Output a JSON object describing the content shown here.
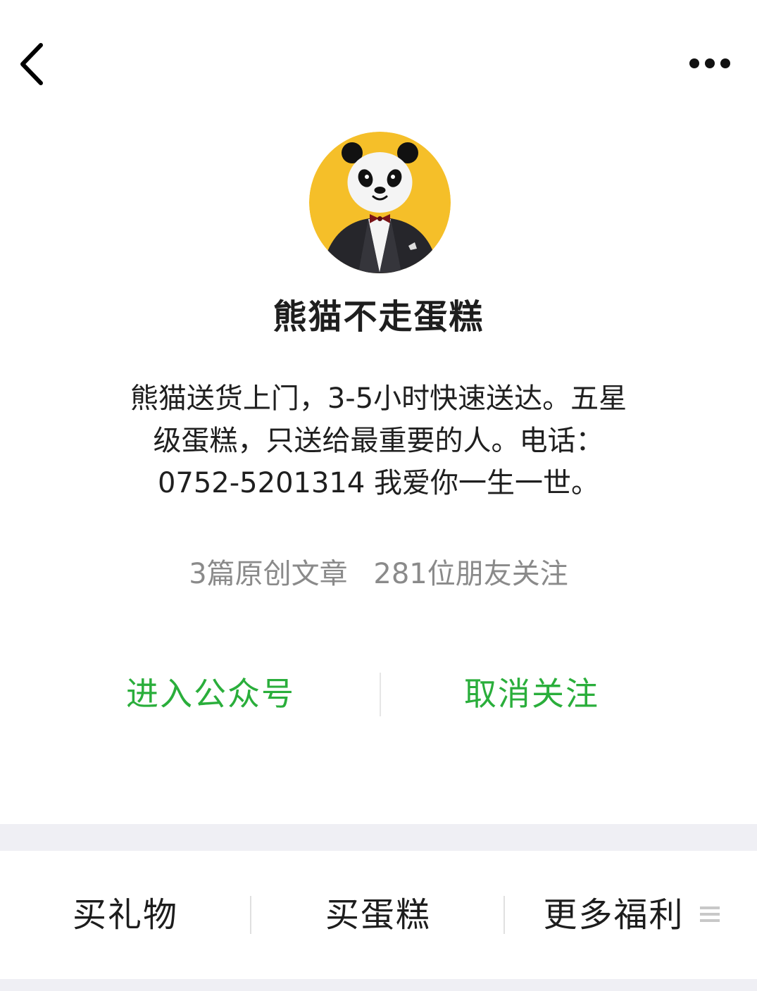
{
  "header": {
    "back_icon": "chevron-left-icon",
    "more_icon": "more-dots-icon"
  },
  "profile": {
    "avatar_icon": "panda-tuxedo-avatar",
    "avatar_bg_color": "#f5bf29",
    "name": "熊猫不走蛋糕",
    "bio_lines": [
      "熊猫送货上门，3-5小时快速送达。五星",
      "级蛋糕，只送给最重要的人。电话：",
      "0752-5201314 我爱你一生一世。"
    ],
    "stats": {
      "articles": "3篇原创文章",
      "followers": "281位朋友关注"
    }
  },
  "actions": {
    "enter_label": "进入公众号",
    "unfollow_label": "取消关注",
    "accent_color": "#2aae3b"
  },
  "menu": {
    "items": [
      {
        "label": "买礼物"
      },
      {
        "label": "买蛋糕"
      },
      {
        "label": "更多福利",
        "icon": "menu-list-icon"
      }
    ]
  }
}
